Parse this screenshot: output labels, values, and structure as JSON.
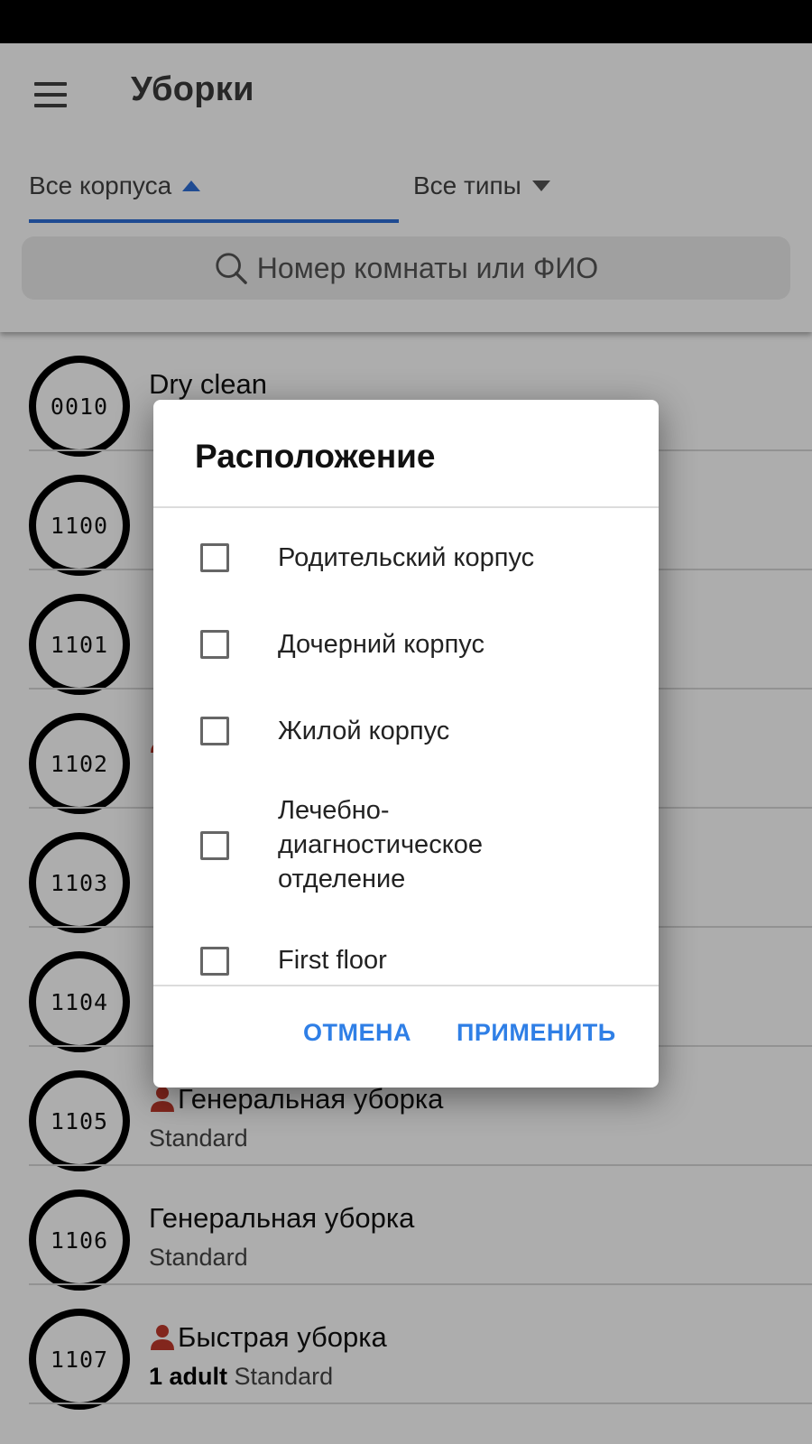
{
  "app": {
    "title": "Уборки"
  },
  "filters": {
    "buildings": "Все корпуса",
    "types": "Все типы"
  },
  "search": {
    "placeholder": "Номер комнаты или ФИО"
  },
  "rooms": [
    {
      "number": "0010",
      "title": "Dry clean",
      "guests": "",
      "category": "",
      "assigned": false
    },
    {
      "number": "1100",
      "title": "",
      "guests": "",
      "category": "",
      "assigned": false
    },
    {
      "number": "1101",
      "title": "",
      "guests": "",
      "category": "",
      "assigned": false
    },
    {
      "number": "1102",
      "title": "",
      "guests": "",
      "category": "",
      "assigned": true
    },
    {
      "number": "1103",
      "title": "",
      "guests": "",
      "category": "",
      "assigned": false
    },
    {
      "number": "1104",
      "title": "",
      "guests": "",
      "category": "",
      "assigned": false
    },
    {
      "number": "1105",
      "title": "Генеральная уборка",
      "guests": "",
      "category": "Standard",
      "assigned": true
    },
    {
      "number": "1106",
      "title": "Генеральная уборка",
      "guests": "",
      "category": "Standard",
      "assigned": false
    },
    {
      "number": "1107",
      "title": "Быстрая уборка",
      "guests": "1 adult",
      "category": "Standard",
      "assigned": true
    }
  ],
  "dialog": {
    "title": "Расположение",
    "options": [
      "Родительский корпус",
      "Дочерний корпус",
      "Жилой корпус",
      "Лечебно-диагностическое отделение",
      "First floor"
    ],
    "cancel": "ОТМЕНА",
    "apply": "ПРИМЕНИТЬ"
  },
  "colors": {
    "accent": "#2f6fd8",
    "button_text": "#2f7fe6",
    "person_icon": "#c0392b",
    "status_bar": "#000000"
  }
}
